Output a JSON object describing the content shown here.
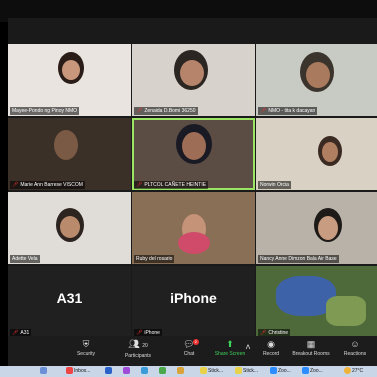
{
  "participants": [
    {
      "name": "Mayee-Pondo ng Pinoy NMO",
      "muted": false
    },
    {
      "name": "Zenaida D.Bomi 36250",
      "muted": true
    },
    {
      "name": "NMO - tita k dacayan",
      "muted": true
    },
    {
      "name": "Marie Ann Barrese VISCOM",
      "muted": true
    },
    {
      "name": "PLTCOL CAÑETE HEINTIE",
      "muted": true
    },
    {
      "name": "Norwin Orcia",
      "muted": false
    },
    {
      "name": "Adette Vela",
      "muted": false
    },
    {
      "name": "Ruby del rosario",
      "muted": false
    },
    {
      "name": "Nancy Anne Dimzon Bala Air Base",
      "muted": false
    },
    {
      "name": "A31",
      "muted": true,
      "display": "A31"
    },
    {
      "name": "iPhone",
      "muted": true,
      "display": "iPhone"
    },
    {
      "name": "Christine",
      "muted": true
    }
  ],
  "toolbar": {
    "security": "Security",
    "participants": "Participants",
    "participants_count": "20",
    "chat": "Chat",
    "chat_badge": "2",
    "share": "Share Screen",
    "record": "Record",
    "breakout": "Breakout Rooms",
    "reactions": "Reactions"
  },
  "taskbar": {
    "inbox": "Inbox...",
    "stick1": "Stick...",
    "stick2": "Stick...",
    "zoom1": "Zoo...",
    "zoom2": "Zoo...",
    "temp": "27°C"
  },
  "colors": {
    "active_speaker": "#9be564",
    "share_green": "#3fd15a",
    "muted_red": "#e33333"
  }
}
